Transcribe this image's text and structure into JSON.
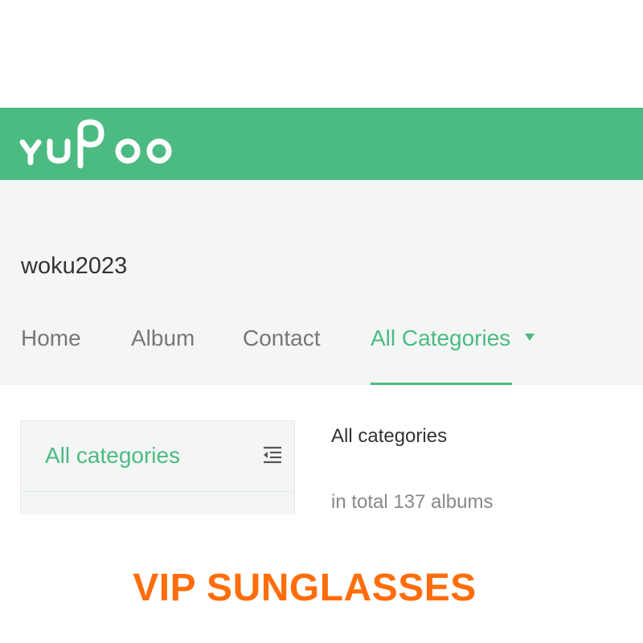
{
  "brand": {
    "logo_text": "yupoo",
    "icon": "yupoo-logo",
    "accent_color": "#4cbb82"
  },
  "store": {
    "name": "woku2023"
  },
  "nav": {
    "items": [
      {
        "label": "Home"
      },
      {
        "label": "Album"
      },
      {
        "label": "Contact"
      },
      {
        "label": "All Categories",
        "active": true,
        "icon": "caret-down-icon"
      }
    ]
  },
  "sidebar": {
    "title": "All categories",
    "toggle_icon": "collapse-menu-icon"
  },
  "main": {
    "title": "All categories",
    "count_text": "in total 137 albums"
  },
  "banner": {
    "text": "VIP SUNGLASSES",
    "color": "#ff6d0a"
  }
}
